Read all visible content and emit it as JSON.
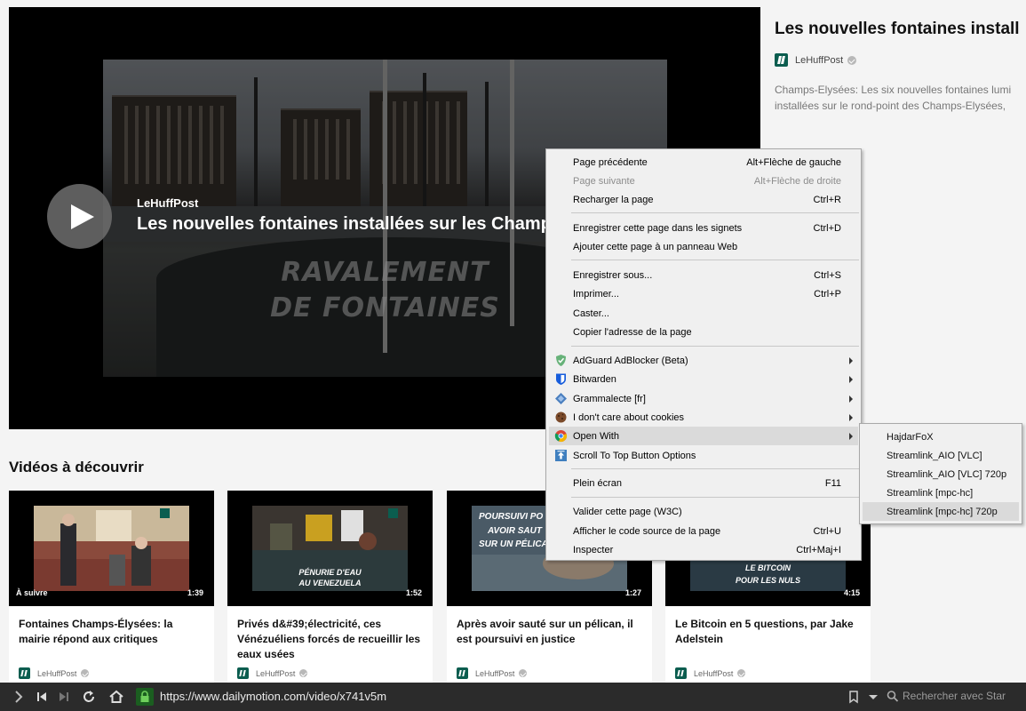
{
  "player": {
    "channel": "LeHuffPost",
    "title": "Les nouvelles fontaines installées sur les Champ",
    "watermark_line1": "RAVALEMENT",
    "watermark_line2": "DE FONTAINES"
  },
  "info": {
    "title": "Les nouvelles fontaines install",
    "channel": "LeHuffPost",
    "description_line1": "Champs-Elysées: Les six nouvelles fontaines lumi",
    "description_line2": "installées sur le rond-point des Champs-Elysées, "
  },
  "section": {
    "title": "Vidéos à découvrir"
  },
  "cards": [
    {
      "title": "Fontaines Champs-Élysées: la mairie répond aux critiques",
      "duration": "1:39",
      "next_label": "À suivre",
      "channel": "LeHuffPost"
    },
    {
      "title": "Privés d&#39;électricité, ces Vénézuéliens forcés de recueillir les eaux usées",
      "duration": "1:52",
      "thumb_text_1": "PÉNURIE D'EAU",
      "thumb_text_2": "AU VENEZUELA",
      "channel": "LeHuffPost"
    },
    {
      "title": "Après avoir sauté sur un pélican, il est poursuivi en justice",
      "duration": "1:27",
      "thumb_text_1": "POURSUIVI PO",
      "thumb_text_2": "AVOIR SAUT",
      "thumb_text_3": "SUR UN PÉLICA",
      "channel": "LeHuffPost"
    },
    {
      "title": "Le Bitcoin en 5 questions, par Jake Adelstein",
      "duration": "4:15",
      "thumb_text_1": "LE BITCOIN",
      "thumb_text_2": "POUR LES NULS",
      "channel": "LeHuffPost"
    }
  ],
  "context_menu": {
    "items": [
      {
        "label": "Page précédente",
        "shortcut": "Alt+Flèche de gauche"
      },
      {
        "label": "Page suivante",
        "shortcut": "Alt+Flèche de droite"
      },
      {
        "label": "Recharger la page",
        "shortcut": "Ctrl+R"
      },
      {
        "label": "Enregistrer cette page dans les signets",
        "shortcut": "Ctrl+D"
      },
      {
        "label": "Ajouter cette page à un panneau Web",
        "shortcut": ""
      },
      {
        "label": "Enregistrer sous...",
        "shortcut": "Ctrl+S"
      },
      {
        "label": "Imprimer...",
        "shortcut": "Ctrl+P"
      },
      {
        "label": "Caster...",
        "shortcut": ""
      },
      {
        "label": "Copier l'adresse de la page",
        "shortcut": ""
      },
      {
        "label": "AdGuard AdBlocker (Beta)",
        "shortcut": ""
      },
      {
        "label": "Bitwarden",
        "shortcut": ""
      },
      {
        "label": "Grammalecte [fr]",
        "shortcut": ""
      },
      {
        "label": "I don't care about cookies",
        "shortcut": ""
      },
      {
        "label": "Open With",
        "shortcut": ""
      },
      {
        "label": "Scroll To Top Button Options",
        "shortcut": ""
      },
      {
        "label": "Plein écran",
        "shortcut": "F11"
      },
      {
        "label": "Valider cette page (W3C)",
        "shortcut": ""
      },
      {
        "label": "Afficher le code source de la page",
        "shortcut": "Ctrl+U"
      },
      {
        "label": "Inspecter",
        "shortcut": "Ctrl+Maj+I"
      }
    ]
  },
  "submenu": {
    "items": [
      "HajdarFoX",
      "Streamlink_AIO [VLC]",
      "Streamlink_AIO [VLC] 720p",
      "Streamlink [mpc-hc]",
      "Streamlink [mpc-hc] 720p"
    ]
  },
  "toolbar": {
    "url": "https://www.dailymotion.com/video/x741v5m",
    "search_placeholder": "Rechercher avec Star"
  },
  "colors": {
    "brand_green": "#0b5d4f",
    "toolbar_bg": "#2b2b2b",
    "menu_bg": "#f0f0f0",
    "menu_highlight": "#dadada"
  }
}
